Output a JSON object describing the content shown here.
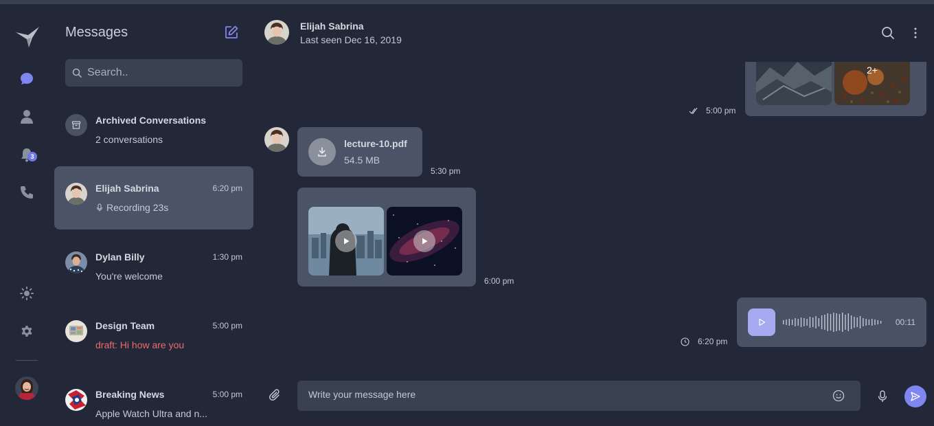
{
  "app": {
    "accent": "#7f86ef",
    "draft_color": "#f06a6a"
  },
  "rail": {
    "items": [
      {
        "icon": "logo-bird-icon"
      },
      {
        "icon": "chat-bubble-icon"
      },
      {
        "icon": "user-icon"
      },
      {
        "icon": "bell-icon"
      },
      {
        "icon": "phone-icon"
      },
      {
        "icon": "sun-icon"
      },
      {
        "icon": "gear-icon"
      }
    ],
    "notification_count": "3"
  },
  "sidebar": {
    "title": "Messages",
    "search_placeholder": "Search..",
    "archived": {
      "title": "Archived Conversations",
      "count_text": "2 conversations"
    },
    "conversations": [
      {
        "name": "Elijah Sabrina",
        "time": "6:20 pm",
        "preview": "Recording 23s",
        "active": true
      },
      {
        "name": "Dylan Billy",
        "time": "1:30 pm",
        "preview": "You're welcome"
      },
      {
        "name": "Design Team",
        "time": "5:00 pm",
        "preview": "draft: Hi how are you",
        "draft": true
      },
      {
        "name": "Breaking News",
        "time": "5:00 pm",
        "preview": "Apple Watch Ultra and n..."
      }
    ]
  },
  "chat": {
    "contact_name": "Elijah Sabrina",
    "last_seen": "Last seen Dec 16, 2019",
    "messages": {
      "gallery_out": {
        "more_label": "2+",
        "time": "5:00 pm"
      },
      "file": {
        "name": "lecture-10.pdf",
        "size": "54.5 MB",
        "time": "5:30 pm"
      },
      "videos": {
        "time": "6:00 pm"
      },
      "audio": {
        "duration": "00:11",
        "time": "6:20 pm"
      }
    },
    "composer_placeholder": "Write your message here"
  }
}
